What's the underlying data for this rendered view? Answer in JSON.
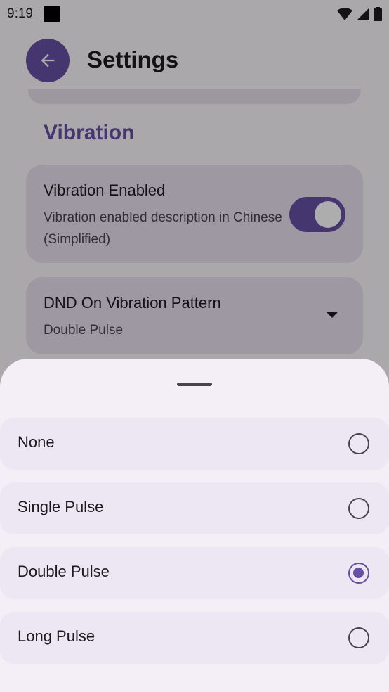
{
  "status_bar": {
    "time": "9:19"
  },
  "app_bar": {
    "title": "Settings"
  },
  "section": {
    "title": "Vibration"
  },
  "vibration_card": {
    "title": "Vibration Enabled",
    "description": "Vibration enabled description in Chinese (Simplified)",
    "enabled": true
  },
  "dnd_card": {
    "title": "DND On Vibration Pattern",
    "value": "Double Pulse"
  },
  "sheet": {
    "options": [
      {
        "label": "None",
        "selected": false
      },
      {
        "label": "Single Pulse",
        "selected": false
      },
      {
        "label": "Double Pulse",
        "selected": true
      },
      {
        "label": "Long Pulse",
        "selected": false
      }
    ]
  },
  "colors": {
    "accent": "#6750a4",
    "sheet_background": "#f4eff7",
    "option_background": "#ede7f3"
  }
}
